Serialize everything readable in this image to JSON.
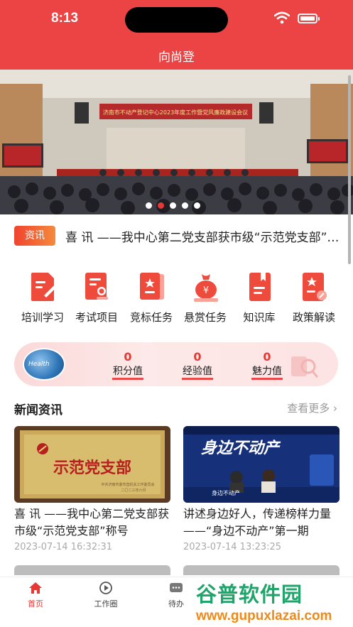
{
  "status_bar": {
    "time": "8:13"
  },
  "nav": {
    "title": "向尚登"
  },
  "banner": {
    "slide_text": "济南市不动产登记中心2023年度工作暨党风廉政建设会议",
    "dots": 5,
    "active_dot": 2
  },
  "notice": {
    "tag": "资讯",
    "text": "喜 讯 ——我中心第二党支部获市级“示范党支部”称号"
  },
  "functions": [
    {
      "label": "培训学习",
      "icon": "training-icon"
    },
    {
      "label": "考试项目",
      "icon": "exam-icon"
    },
    {
      "label": "竞标任务",
      "icon": "bidding-icon"
    },
    {
      "label": "悬赏任务",
      "icon": "reward-icon"
    },
    {
      "label": "知识库",
      "icon": "knowledge-icon"
    },
    {
      "label": "政策解读",
      "icon": "policy-icon"
    }
  ],
  "stats": {
    "avatar_text": "Health",
    "items": [
      {
        "label": "积分值",
        "value": "0"
      },
      {
        "label": "经验值",
        "value": "0"
      },
      {
        "label": "魅力值",
        "value": "0"
      }
    ]
  },
  "news_section": {
    "title": "新闻资讯",
    "more": "查看更多"
  },
  "news": [
    {
      "title": "喜 讯 ——我中心第二党支部获市级“示范党支部”称号",
      "time": "2023-07-14 16:32:31",
      "image_caption": "示范党支部",
      "image_sub": "中共济南市委市直机关工作委员会\n二〇二三年六月"
    },
    {
      "title": "讲述身边好人，传递榜样力量 ——“身边不动产”第一期",
      "time": "2023-07-14 13:23:25",
      "image_caption": "身边不动产",
      "image_sub": "身边不动产"
    }
  ],
  "tabbar": [
    {
      "label": "首页",
      "icon": "home-icon",
      "active": true
    },
    {
      "label": "工作圈",
      "icon": "work-circle-icon",
      "active": false
    },
    {
      "label": "待办",
      "icon": "todo-icon",
      "active": false
    }
  ],
  "watermark": {
    "top": "谷普软件园",
    "bottom": "www.gupuxlazai.com"
  },
  "colors": {
    "primary": "#ec4444",
    "accent": "#e53935"
  }
}
